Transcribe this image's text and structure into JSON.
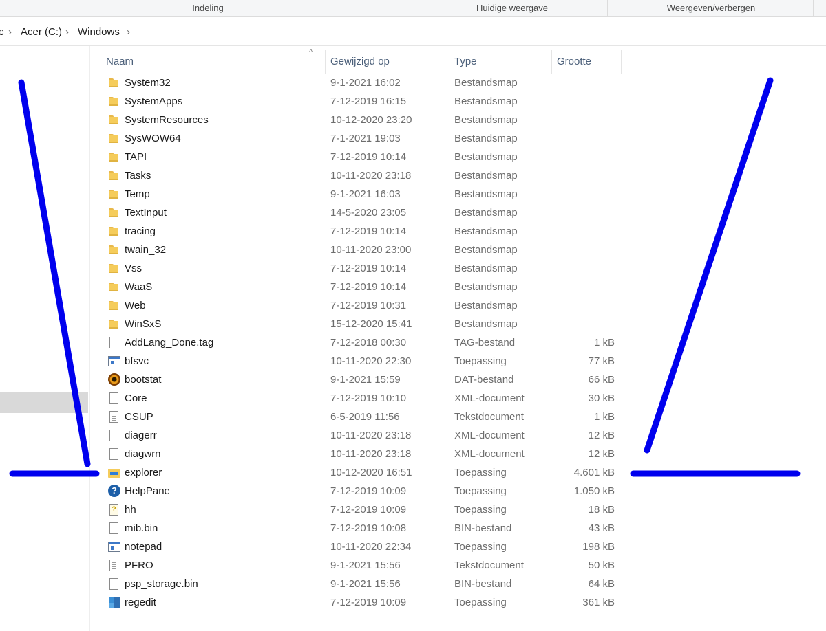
{
  "ribbon": {
    "groups": [
      "Indeling",
      "Huidige weergave",
      "Weergeven/verbergen"
    ]
  },
  "address": {
    "crumbs": [
      "c",
      "Acer (C:)",
      "Windows"
    ]
  },
  "columns": {
    "name": "Naam",
    "modified": "Gewijzigd op",
    "type": "Type",
    "size": "Grootte"
  },
  "files": [
    {
      "icon": "folder-icon",
      "name": "System32",
      "modified": "9-1-2021 16:02",
      "type": "Bestandsmap",
      "size": ""
    },
    {
      "icon": "folder-icon",
      "name": "SystemApps",
      "modified": "7-12-2019 16:15",
      "type": "Bestandsmap",
      "size": ""
    },
    {
      "icon": "folder-icon",
      "name": "SystemResources",
      "modified": "10-12-2020 23:20",
      "type": "Bestandsmap",
      "size": ""
    },
    {
      "icon": "folder-icon",
      "name": "SysWOW64",
      "modified": "7-1-2021 19:03",
      "type": "Bestandsmap",
      "size": ""
    },
    {
      "icon": "folder-icon",
      "name": "TAPI",
      "modified": "7-12-2019 10:14",
      "type": "Bestandsmap",
      "size": ""
    },
    {
      "icon": "folder-icon",
      "name": "Tasks",
      "modified": "10-11-2020 23:18",
      "type": "Bestandsmap",
      "size": ""
    },
    {
      "icon": "folder-icon",
      "name": "Temp",
      "modified": "9-1-2021 16:03",
      "type": "Bestandsmap",
      "size": ""
    },
    {
      "icon": "folder-icon",
      "name": "TextInput",
      "modified": "14-5-2020 23:05",
      "type": "Bestandsmap",
      "size": ""
    },
    {
      "icon": "folder-icon",
      "name": "tracing",
      "modified": "7-12-2019 10:14",
      "type": "Bestandsmap",
      "size": ""
    },
    {
      "icon": "folder-icon",
      "name": "twain_32",
      "modified": "10-11-2020 23:00",
      "type": "Bestandsmap",
      "size": ""
    },
    {
      "icon": "folder-icon",
      "name": "Vss",
      "modified": "7-12-2019 10:14",
      "type": "Bestandsmap",
      "size": ""
    },
    {
      "icon": "folder-icon",
      "name": "WaaS",
      "modified": "7-12-2019 10:14",
      "type": "Bestandsmap",
      "size": ""
    },
    {
      "icon": "folder-icon",
      "name": "Web",
      "modified": "7-12-2019 10:31",
      "type": "Bestandsmap",
      "size": ""
    },
    {
      "icon": "folder-icon",
      "name": "WinSxS",
      "modified": "15-12-2020 15:41",
      "type": "Bestandsmap",
      "size": ""
    },
    {
      "icon": "document-icon",
      "name": "AddLang_Done.tag",
      "modified": "7-12-2018 00:30",
      "type": "TAG-bestand",
      "size": "1 kB"
    },
    {
      "icon": "application-icon",
      "name": "bfsvc",
      "modified": "10-11-2020 22:30",
      "type": "Toepassing",
      "size": "77 kB"
    },
    {
      "icon": "bootstat-icon",
      "name": "bootstat",
      "modified": "9-1-2021 15:59",
      "type": "DAT-bestand",
      "size": "66 kB"
    },
    {
      "icon": "document-icon",
      "name": "Core",
      "modified": "7-12-2019 10:10",
      "type": "XML-document",
      "size": "30 kB"
    },
    {
      "icon": "text-document-icon",
      "name": "CSUP",
      "modified": "6-5-2019 11:56",
      "type": "Tekstdocument",
      "size": "1 kB"
    },
    {
      "icon": "document-icon",
      "name": "diagerr",
      "modified": "10-11-2020 23:18",
      "type": "XML-document",
      "size": "12 kB"
    },
    {
      "icon": "document-icon",
      "name": "diagwrn",
      "modified": "10-11-2020 23:18",
      "type": "XML-document",
      "size": "12 kB"
    },
    {
      "icon": "explorer-icon",
      "name": "explorer",
      "modified": "10-12-2020 16:51",
      "type": "Toepassing",
      "size": "4.601 kB"
    },
    {
      "icon": "help-icon",
      "name": "HelpPane",
      "modified": "7-12-2019 10:09",
      "type": "Toepassing",
      "size": "1.050 kB"
    },
    {
      "icon": "help-file-icon",
      "name": "hh",
      "modified": "7-12-2019 10:09",
      "type": "Toepassing",
      "size": "18 kB"
    },
    {
      "icon": "document-icon",
      "name": "mib.bin",
      "modified": "7-12-2019 10:08",
      "type": "BIN-bestand",
      "size": "43 kB"
    },
    {
      "icon": "application-icon",
      "name": "notepad",
      "modified": "10-11-2020 22:34",
      "type": "Toepassing",
      "size": "198 kB"
    },
    {
      "icon": "text-document-icon",
      "name": "PFRO",
      "modified": "9-1-2021 15:56",
      "type": "Tekstdocument",
      "size": "50 kB"
    },
    {
      "icon": "document-icon",
      "name": "psp_storage.bin",
      "modified": "9-1-2021 15:56",
      "type": "BIN-bestand",
      "size": "64 kB"
    },
    {
      "icon": "registry-editor-icon",
      "name": "regedit",
      "modified": "7-12-2019 10:09",
      "type": "Toepassing",
      "size": "361 kB"
    }
  ],
  "colors": {
    "header_text": "#4c607a",
    "annotation_stroke": "#0000ee",
    "folder": "#f5cc5b",
    "selection": "#d9d9d9"
  }
}
